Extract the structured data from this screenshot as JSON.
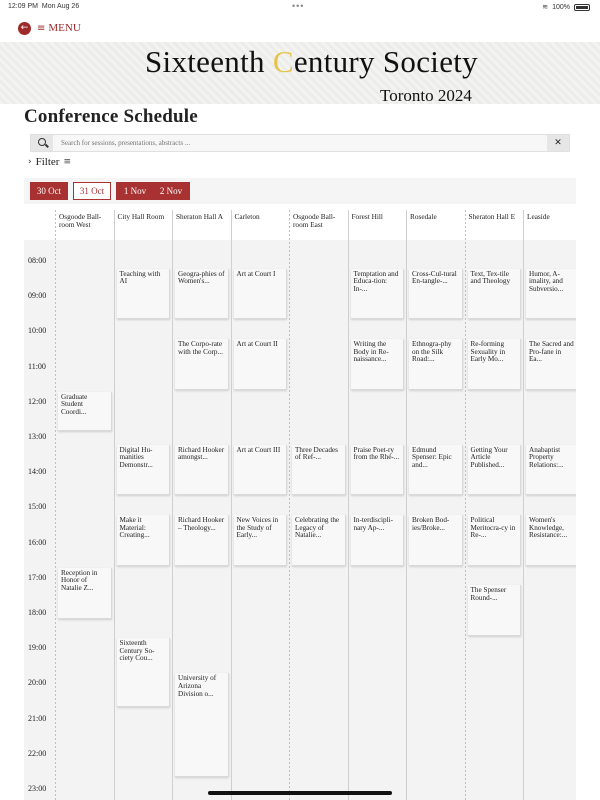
{
  "status_bar": {
    "time": "12:09 PM",
    "date": "Mon Aug 26",
    "dots": "•••",
    "battery": "100%"
  },
  "nav": {
    "back_icon": "arrow-left-icon",
    "menu_icon": "hamburger-icon",
    "menu_label": "MENU"
  },
  "banner": {
    "title_part1": "Sixteenth ",
    "title_accent": "C",
    "title_part2": "entury Society",
    "subtitle": "Toronto 2024"
  },
  "page_title": "Conference Schedule",
  "search": {
    "placeholder": "Search for sessions, presentations, abstracts ...",
    "value": "",
    "clear_label": "✕"
  },
  "filter": {
    "label": "Filter",
    "chevron": "›",
    "icon": "≡"
  },
  "dates": [
    {
      "label": "30 Oct",
      "selected": false
    },
    {
      "label": "31 Oct",
      "selected": true
    },
    {
      "label": "1 Nov",
      "selected": false
    },
    {
      "label": "2 Nov",
      "selected": false
    }
  ],
  "rooms": [
    "Osgoode Ball-room West",
    "City Hall Room",
    "Sheraton Hall A",
    "Carleton",
    "Osgoode Ball-room East",
    "Forest Hill",
    "Rosedale",
    "Sheraton Hall E",
    "Leaside"
  ],
  "times": [
    "08:00",
    "09:00",
    "10:00",
    "11:00",
    "12:00",
    "13:00",
    "14:00",
    "15:00",
    "16:00",
    "17:00",
    "18:00",
    "19:00",
    "20:00",
    "21:00",
    "22:00",
    "23:00"
  ],
  "events": [
    {
      "room": 1,
      "start": 8.5,
      "end": 10.0,
      "text": "Teaching with AI"
    },
    {
      "room": 2,
      "start": 8.5,
      "end": 10.0,
      "text": "Geogra-phies of Women's..."
    },
    {
      "room": 3,
      "start": 8.5,
      "end": 10.0,
      "text": "Art at Court I"
    },
    {
      "room": 5,
      "start": 8.5,
      "end": 10.0,
      "text": "Temptation and Educa-tion: In-..."
    },
    {
      "room": 6,
      "start": 8.5,
      "end": 10.0,
      "text": "Cross-Cul-tural En-tangle-..."
    },
    {
      "room": 7,
      "start": 8.5,
      "end": 10.0,
      "text": "Text, Tex-tile and Theology"
    },
    {
      "room": 8,
      "start": 8.5,
      "end": 10.0,
      "text": "Humor, A-imality, and Subversio..."
    },
    {
      "room": 2,
      "start": 10.5,
      "end": 12.0,
      "text": "The Corpo-rate with the Corp..."
    },
    {
      "room": 3,
      "start": 10.5,
      "end": 12.0,
      "text": "Art at Court II"
    },
    {
      "room": 5,
      "start": 10.5,
      "end": 12.0,
      "text": "Writing the Body in Re-naissance..."
    },
    {
      "room": 6,
      "start": 10.5,
      "end": 12.0,
      "text": "Ethnogra-phy on the Silk Road:..."
    },
    {
      "room": 7,
      "start": 10.5,
      "end": 12.0,
      "text": "Re-forming Sexuality in Early Mo..."
    },
    {
      "room": 8,
      "start": 10.5,
      "end": 12.0,
      "text": "The Sacred and Pro-fane in Ea..."
    },
    {
      "room": 1,
      "start": 13.5,
      "end": 15.0,
      "text": "Digital Hu-manities Demonstr..."
    },
    {
      "room": 2,
      "start": 13.5,
      "end": 15.0,
      "text": "Richard Hooker amongst..."
    },
    {
      "room": 3,
      "start": 13.5,
      "end": 15.0,
      "text": "Art at Court III"
    },
    {
      "room": 4,
      "start": 13.5,
      "end": 15.0,
      "text": "Three Decades of Ref-..."
    },
    {
      "room": 5,
      "start": 13.5,
      "end": 15.0,
      "text": "Praise Poet-ry from the Rhé-..."
    },
    {
      "room": 6,
      "start": 13.5,
      "end": 15.0,
      "text": "Edmund Spenser: Epic and..."
    },
    {
      "room": 7,
      "start": 13.5,
      "end": 15.0,
      "text": "Getting Your Article Published..."
    },
    {
      "room": 8,
      "start": 13.5,
      "end": 15.0,
      "text": "Anabaptist Property Relations:..."
    },
    {
      "room": 1,
      "start": 15.5,
      "end": 17.0,
      "text": "Make it Material: Creating..."
    },
    {
      "room": 2,
      "start": 15.5,
      "end": 17.0,
      "text": "Richard Hooker – Theology..."
    },
    {
      "room": 3,
      "start": 15.5,
      "end": 17.0,
      "text": "New Voices in the Study of Early..."
    },
    {
      "room": 4,
      "start": 15.5,
      "end": 17.0,
      "text": "Celebrating the Legacy of Natalie..."
    },
    {
      "room": 5,
      "start": 15.5,
      "end": 17.0,
      "text": "In-terdiscipli-nary Ap-..."
    },
    {
      "room": 6,
      "start": 15.5,
      "end": 17.0,
      "text": "Broken Bod-ies/Broke..."
    },
    {
      "room": 7,
      "start": 15.5,
      "end": 17.0,
      "text": "Political Meritocra-cy in Re-..."
    },
    {
      "room": 8,
      "start": 15.5,
      "end": 17.0,
      "text": "Women's Knowledge, Resistance:..."
    },
    {
      "room": 0,
      "start": 17.0,
      "end": 18.5,
      "text": "Reception in Honor of Natalie Z..."
    },
    {
      "room": 7,
      "start": 17.5,
      "end": 19.0,
      "text": "The Spenser Round-..."
    },
    {
      "room": 1,
      "start": 19.0,
      "end": 21.0,
      "text": "Sixteenth Century So-ciety Cou..."
    },
    {
      "room": 2,
      "start": 20.0,
      "end": 23.0,
      "text": "University of Arizona Division o..."
    }
  ],
  "stacked_event": {
    "room": 0,
    "start": 12.0,
    "end": 13.1,
    "lines": [
      "Graduate",
      "Student",
      "Coordi..."
    ]
  }
}
